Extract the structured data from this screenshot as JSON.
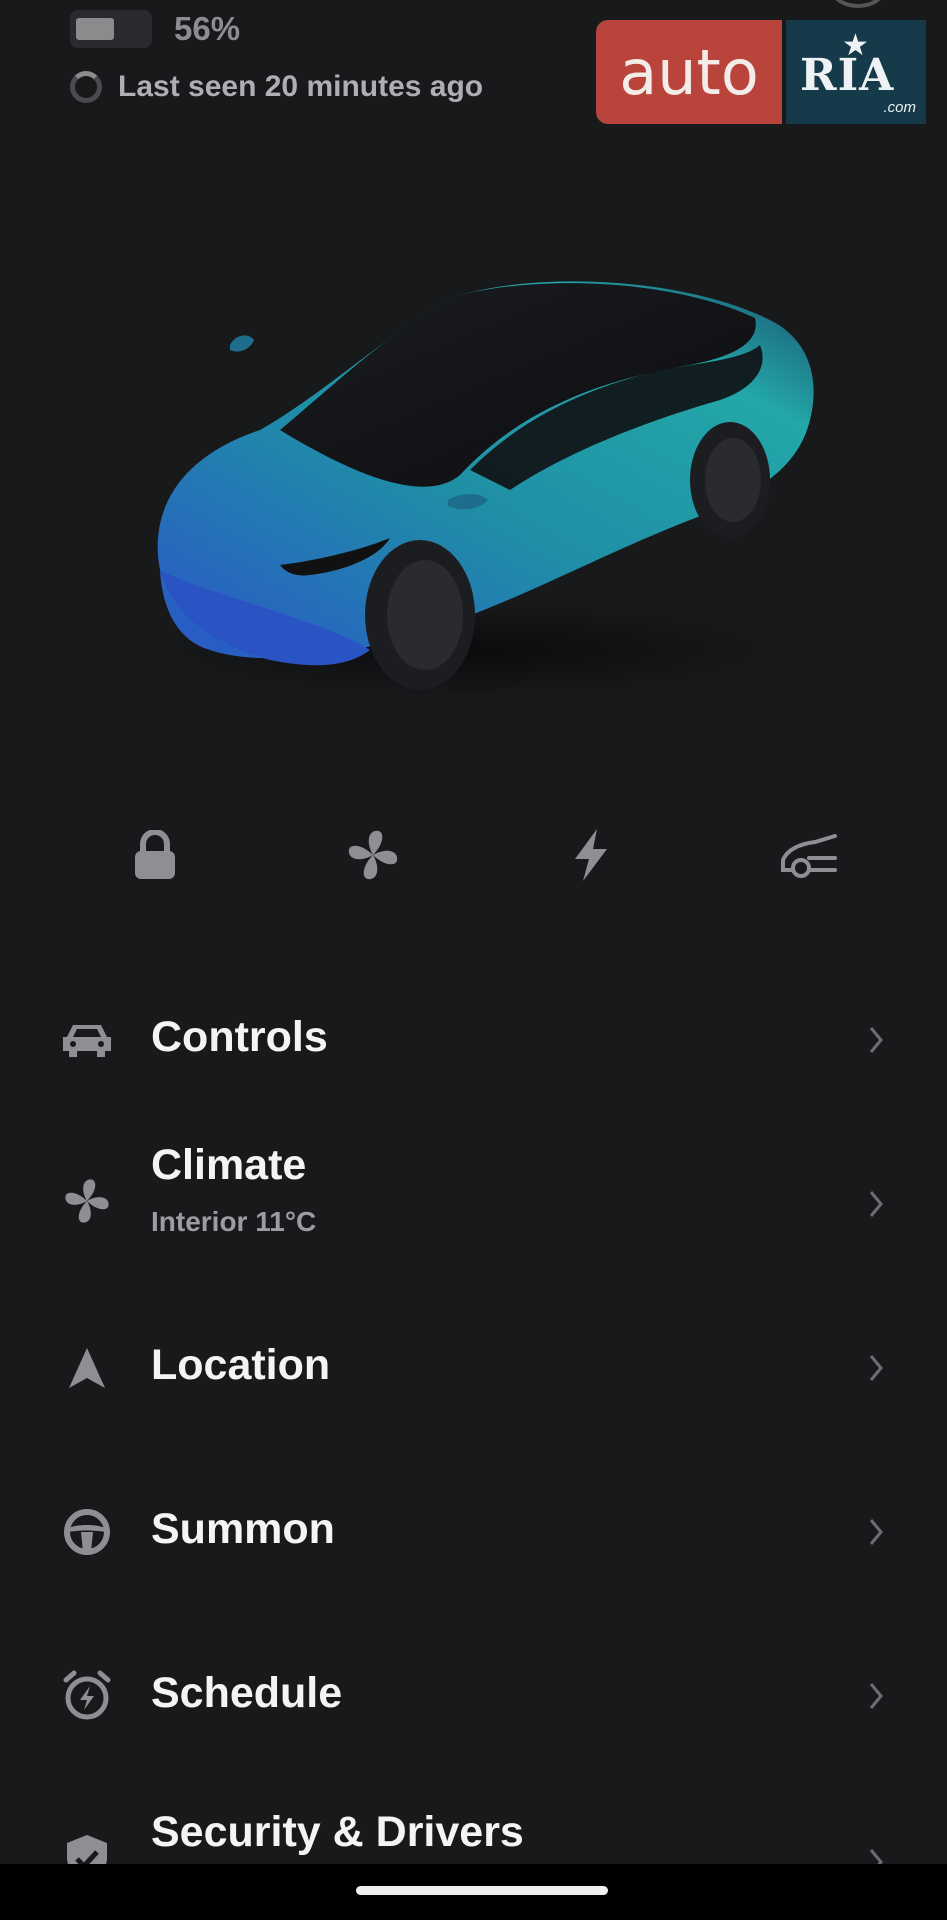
{
  "status": {
    "battery_percent": 56,
    "battery_label": "56%",
    "last_seen": "Last seen 20 minutes ago"
  },
  "watermark": {
    "left_text": "auto",
    "right_text": "RIA",
    "suffix": ".com",
    "left_color": "#b8443c",
    "right_color": "#153a4a"
  },
  "car": {
    "paint_color": "#1f8fa0",
    "secondary_color": "#2a4fb0"
  },
  "quick_actions": [
    {
      "icon": "lock-icon"
    },
    {
      "icon": "fan-icon"
    },
    {
      "icon": "bolt-icon"
    },
    {
      "icon": "frunk-icon"
    }
  ],
  "menu": {
    "items": [
      {
        "icon": "car-icon",
        "label": "Controls",
        "sub": ""
      },
      {
        "icon": "fan-icon",
        "label": "Climate",
        "sub": "Interior 11°C"
      },
      {
        "icon": "location-arrow-icon",
        "label": "Location",
        "sub": ""
      },
      {
        "icon": "steering-wheel-icon",
        "label": "Summon",
        "sub": ""
      },
      {
        "icon": "alarm-clock-icon",
        "label": "Schedule",
        "sub": ""
      },
      {
        "icon": "shield-check-icon",
        "label": "Security & Drivers",
        "sub": ""
      }
    ]
  },
  "colors": {
    "background": "#18191b",
    "icon_gray": "#8e8f92",
    "text": "#f4f4f4"
  }
}
